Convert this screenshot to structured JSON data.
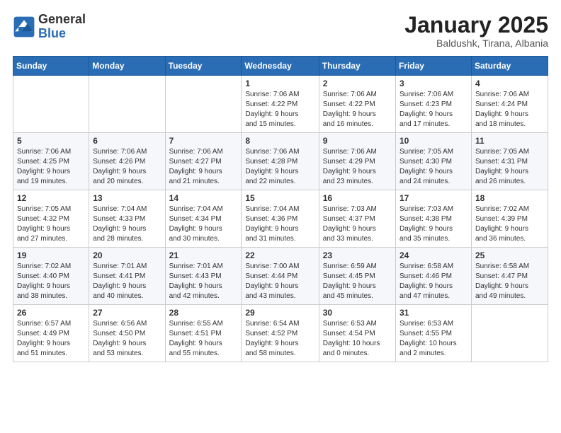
{
  "logo": {
    "general": "General",
    "blue": "Blue"
  },
  "header": {
    "month": "January 2025",
    "location": "Baldushk, Tirana, Albania"
  },
  "weekdays": [
    "Sunday",
    "Monday",
    "Tuesday",
    "Wednesday",
    "Thursday",
    "Friday",
    "Saturday"
  ],
  "weeks": [
    [
      {
        "day": "",
        "content": ""
      },
      {
        "day": "",
        "content": ""
      },
      {
        "day": "",
        "content": ""
      },
      {
        "day": "1",
        "content": "Sunrise: 7:06 AM\nSunset: 4:22 PM\nDaylight: 9 hours\nand 15 minutes."
      },
      {
        "day": "2",
        "content": "Sunrise: 7:06 AM\nSunset: 4:22 PM\nDaylight: 9 hours\nand 16 minutes."
      },
      {
        "day": "3",
        "content": "Sunrise: 7:06 AM\nSunset: 4:23 PM\nDaylight: 9 hours\nand 17 minutes."
      },
      {
        "day": "4",
        "content": "Sunrise: 7:06 AM\nSunset: 4:24 PM\nDaylight: 9 hours\nand 18 minutes."
      }
    ],
    [
      {
        "day": "5",
        "content": "Sunrise: 7:06 AM\nSunset: 4:25 PM\nDaylight: 9 hours\nand 19 minutes."
      },
      {
        "day": "6",
        "content": "Sunrise: 7:06 AM\nSunset: 4:26 PM\nDaylight: 9 hours\nand 20 minutes."
      },
      {
        "day": "7",
        "content": "Sunrise: 7:06 AM\nSunset: 4:27 PM\nDaylight: 9 hours\nand 21 minutes."
      },
      {
        "day": "8",
        "content": "Sunrise: 7:06 AM\nSunset: 4:28 PM\nDaylight: 9 hours\nand 22 minutes."
      },
      {
        "day": "9",
        "content": "Sunrise: 7:06 AM\nSunset: 4:29 PM\nDaylight: 9 hours\nand 23 minutes."
      },
      {
        "day": "10",
        "content": "Sunrise: 7:05 AM\nSunset: 4:30 PM\nDaylight: 9 hours\nand 24 minutes."
      },
      {
        "day": "11",
        "content": "Sunrise: 7:05 AM\nSunset: 4:31 PM\nDaylight: 9 hours\nand 26 minutes."
      }
    ],
    [
      {
        "day": "12",
        "content": "Sunrise: 7:05 AM\nSunset: 4:32 PM\nDaylight: 9 hours\nand 27 minutes."
      },
      {
        "day": "13",
        "content": "Sunrise: 7:04 AM\nSunset: 4:33 PM\nDaylight: 9 hours\nand 28 minutes."
      },
      {
        "day": "14",
        "content": "Sunrise: 7:04 AM\nSunset: 4:34 PM\nDaylight: 9 hours\nand 30 minutes."
      },
      {
        "day": "15",
        "content": "Sunrise: 7:04 AM\nSunset: 4:36 PM\nDaylight: 9 hours\nand 31 minutes."
      },
      {
        "day": "16",
        "content": "Sunrise: 7:03 AM\nSunset: 4:37 PM\nDaylight: 9 hours\nand 33 minutes."
      },
      {
        "day": "17",
        "content": "Sunrise: 7:03 AM\nSunset: 4:38 PM\nDaylight: 9 hours\nand 35 minutes."
      },
      {
        "day": "18",
        "content": "Sunrise: 7:02 AM\nSunset: 4:39 PM\nDaylight: 9 hours\nand 36 minutes."
      }
    ],
    [
      {
        "day": "19",
        "content": "Sunrise: 7:02 AM\nSunset: 4:40 PM\nDaylight: 9 hours\nand 38 minutes."
      },
      {
        "day": "20",
        "content": "Sunrise: 7:01 AM\nSunset: 4:41 PM\nDaylight: 9 hours\nand 40 minutes."
      },
      {
        "day": "21",
        "content": "Sunrise: 7:01 AM\nSunset: 4:43 PM\nDaylight: 9 hours\nand 42 minutes."
      },
      {
        "day": "22",
        "content": "Sunrise: 7:00 AM\nSunset: 4:44 PM\nDaylight: 9 hours\nand 43 minutes."
      },
      {
        "day": "23",
        "content": "Sunrise: 6:59 AM\nSunset: 4:45 PM\nDaylight: 9 hours\nand 45 minutes."
      },
      {
        "day": "24",
        "content": "Sunrise: 6:58 AM\nSunset: 4:46 PM\nDaylight: 9 hours\nand 47 minutes."
      },
      {
        "day": "25",
        "content": "Sunrise: 6:58 AM\nSunset: 4:47 PM\nDaylight: 9 hours\nand 49 minutes."
      }
    ],
    [
      {
        "day": "26",
        "content": "Sunrise: 6:57 AM\nSunset: 4:49 PM\nDaylight: 9 hours\nand 51 minutes."
      },
      {
        "day": "27",
        "content": "Sunrise: 6:56 AM\nSunset: 4:50 PM\nDaylight: 9 hours\nand 53 minutes."
      },
      {
        "day": "28",
        "content": "Sunrise: 6:55 AM\nSunset: 4:51 PM\nDaylight: 9 hours\nand 55 minutes."
      },
      {
        "day": "29",
        "content": "Sunrise: 6:54 AM\nSunset: 4:52 PM\nDaylight: 9 hours\nand 58 minutes."
      },
      {
        "day": "30",
        "content": "Sunrise: 6:53 AM\nSunset: 4:54 PM\nDaylight: 10 hours\nand 0 minutes."
      },
      {
        "day": "31",
        "content": "Sunrise: 6:53 AM\nSunset: 4:55 PM\nDaylight: 10 hours\nand 2 minutes."
      },
      {
        "day": "",
        "content": ""
      }
    ]
  ]
}
